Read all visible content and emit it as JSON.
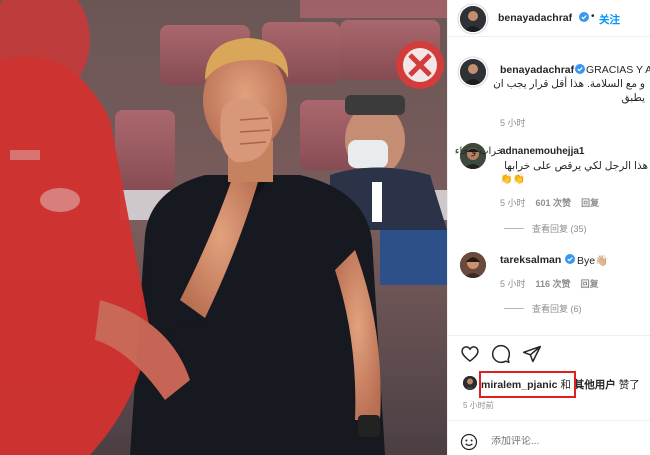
{
  "post": {
    "author": "benayadachraf",
    "follow_label": "关注",
    "dot": "•",
    "caption_author": "benayadachraf",
    "caption_text_1": "GRACIAS Y A",
    "caption_text_2": "و مع السلامة. هذا أقل قرار يجب ان",
    "caption_text_3": "يطبق",
    "caption_time": "5 小时"
  },
  "comments": [
    {
      "author": "adnanemouhejja1",
      "line1": "خراب و جاء",
      "line2": "هذا الرجل لكي يرقص على خرابها",
      "emoji": "👏👏",
      "time": "5 小时",
      "likes": "601 次赞",
      "reply": "回复",
      "view_replies": "查看回复 (35)"
    },
    {
      "author": "tareksalman",
      "text": "Bye👋🏼",
      "time": "5 小时",
      "likes": "116 次赞",
      "reply": "回复",
      "view_replies": "查看回复 (6)"
    }
  ],
  "likes": {
    "user": "miralem_pjanic",
    "and": " 和 ",
    "others": "其他用户",
    "suffix": " 赞了",
    "time": "5 小时前"
  },
  "add_comment": {
    "placeholder": "添加评论..."
  },
  "icons": {
    "verified": "verified-badge-icon",
    "like": "heart-icon",
    "comment": "comment-bubble-icon",
    "share": "paper-plane-icon",
    "emoji": "smiley-icon"
  },
  "colors": {
    "link_blue": "#0095f6",
    "secondary_text": "#8e8e8e",
    "highlight_box": "#e02020"
  }
}
